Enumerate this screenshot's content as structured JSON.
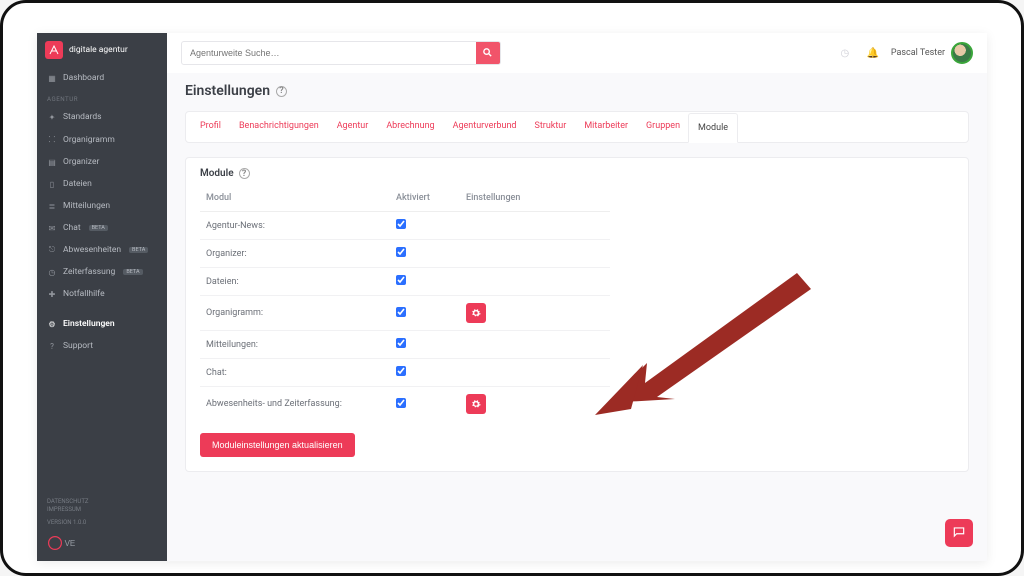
{
  "brand": {
    "name": "digitale agentur"
  },
  "sidebar": {
    "dashboard": "Dashboard",
    "section_label": "AGENTUR",
    "items": [
      {
        "label": "Standards"
      },
      {
        "label": "Organigramm"
      },
      {
        "label": "Organizer"
      },
      {
        "label": "Dateien"
      },
      {
        "label": "Mitteilungen"
      },
      {
        "label": "Chat",
        "badge": "BETA"
      },
      {
        "label": "Abwesenheiten",
        "badge": "BETA"
      },
      {
        "label": "Zeiterfassung",
        "badge": "BETA"
      },
      {
        "label": "Notfallhilfe"
      }
    ],
    "settings": "Einstellungen",
    "support": "Support",
    "footer": {
      "privacy": "DATENSCHUTZ",
      "impressum": "IMPRESSUM",
      "version": "VERSION 1.0.0"
    }
  },
  "search": {
    "placeholder": "Agenturweite Suche…"
  },
  "user": {
    "name": "Pascal Tester"
  },
  "page": {
    "title": "Einstellungen",
    "card_title": "Module",
    "tabs": {
      "profil": "Profil",
      "benach": "Benachrichtigungen",
      "agentur": "Agentur",
      "abrechnung": "Abrechnung",
      "verbund": "Agenturverbund",
      "struktur": "Struktur",
      "mitarbeiter": "Mitarbeiter",
      "gruppen": "Gruppen",
      "module": "Module"
    },
    "columns": {
      "modul": "Modul",
      "aktiviert": "Aktiviert",
      "einstellungen": "Einstellungen"
    },
    "rows": [
      {
        "label": "Agentur-News:"
      },
      {
        "label": "Organizer:"
      },
      {
        "label": "Dateien:"
      },
      {
        "label": "Organigramm:",
        "gear": true
      },
      {
        "label": "Mitteilungen:"
      },
      {
        "label": "Chat:"
      },
      {
        "label": "Abwesenheits- und Zeiterfassung:",
        "gear": true
      }
    ],
    "submit": "Moduleinstellungen aktualisieren"
  },
  "colors": {
    "accent": "#ed3b58"
  }
}
